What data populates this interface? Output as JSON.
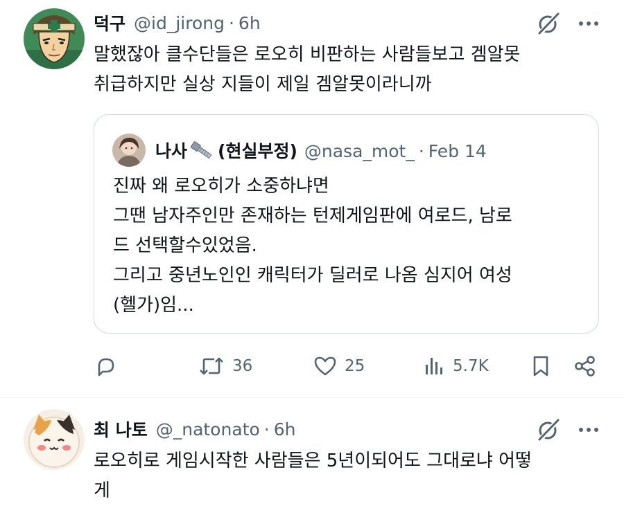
{
  "tweets": [
    {
      "author_name": "덕구",
      "handle": "@id_jirong",
      "separator": "·",
      "time": "6h",
      "lines": [
        "말했잖아 클수단들은 로오히 비판하는 사람들보고 겜알못",
        "취급하지만 실상 지들이 제일 겜알못이라니까"
      ],
      "quote": {
        "author_name": "나사🔩 (현실부정)",
        "author_name_text": "나사",
        "author_name_suffix": "(현실부정)",
        "handle": "@nasa_mot_",
        "separator": "·",
        "date": "Feb 14",
        "lines": [
          "진짜 왜 로오히가 소중하냐면",
          "그땐 남자주인만 존재하는 턴제게임판에 여로드, 남로",
          "드 선택할수있었음.",
          "그리고 중년노인인 캐릭터가 딜러로 나옴 심지어 여성",
          "(헬가)임..."
        ]
      },
      "actions": {
        "reply_icon": "reply-icon",
        "retweet_icon": "retweet-icon",
        "retweets": "36",
        "like_icon": "heart-icon",
        "likes": "25",
        "views_icon": "views-icon",
        "views": "5.7K",
        "bookmark_icon": "bookmark-icon",
        "share_icon": "share-icon"
      }
    },
    {
      "author_name": "최 나토",
      "handle": "@_natonato",
      "separator": "·",
      "time": "6h",
      "lines": [
        "로오히로 게임시작한 사람들은 5년이되어도 그대로냐 어떻",
        "게"
      ]
    }
  ],
  "colors": {
    "text": "#0f1419",
    "muted": "#536471",
    "border": "#cfd9de",
    "divider": "#eff3f4"
  }
}
